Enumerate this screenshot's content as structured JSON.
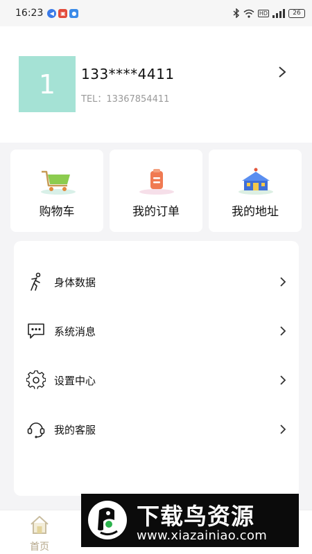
{
  "status_bar": {
    "time": "16:23",
    "network_label": "5G",
    "hd_label": "HD",
    "battery": "26"
  },
  "profile": {
    "avatar_text": "1",
    "masked_phone": "133****4411",
    "tel_label": "TEL：13367854411"
  },
  "cards": [
    {
      "label": "购物车",
      "icon": "shopping-cart-icon"
    },
    {
      "label": "我的订单",
      "icon": "order-icon"
    },
    {
      "label": "我的地址",
      "icon": "address-house-icon"
    }
  ],
  "menu": [
    {
      "label": "身体数据",
      "icon": "body-data-icon"
    },
    {
      "label": "系统消息",
      "icon": "message-icon"
    },
    {
      "label": "设置中心",
      "icon": "gear-icon"
    },
    {
      "label": "我的客服",
      "icon": "customer-service-icon"
    }
  ],
  "tabbar": {
    "home_label": "首页"
  },
  "watermark": {
    "title": "下载鸟资源",
    "url": "www.xiazainiao.com"
  },
  "colors": {
    "avatar_bg": "#a5e2d5",
    "tab_active": "#b5a78a",
    "page_bg": "#f4f4f6"
  }
}
